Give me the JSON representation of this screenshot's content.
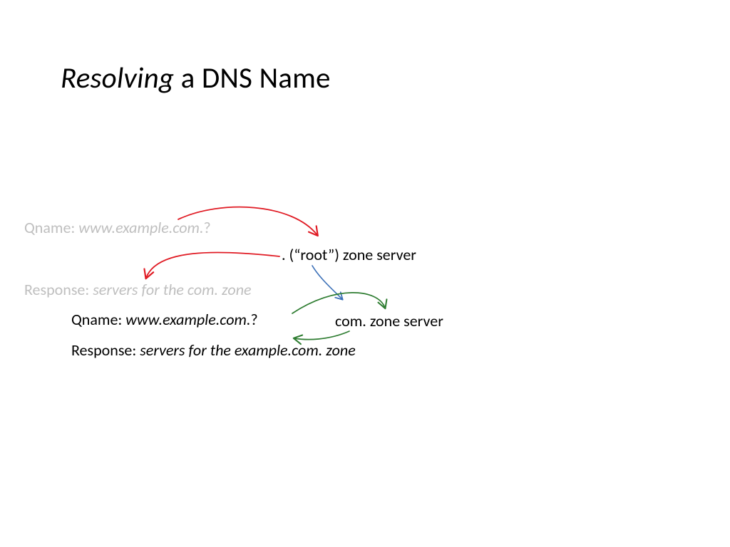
{
  "title": {
    "emph": "Resolving",
    "rest": " a DNS Name"
  },
  "qname1": {
    "prefix": "Qname: ",
    "value": "www.example.com.",
    "suffix": "?"
  },
  "root_server": ". (“root”) zone server",
  "response1": {
    "prefix": "Response: ",
    "value": "servers for the com. zone"
  },
  "qname2": {
    "prefix": "Qname: ",
    "value": "www.example.com.",
    "suffix": "?"
  },
  "com_server": "com. zone server",
  "response2": {
    "prefix": "Response: ",
    "value": "servers for the example.com. zone"
  },
  "colors": {
    "red": "#e01b24",
    "blue": "#3a6fb7",
    "green": "#2f7d32"
  }
}
